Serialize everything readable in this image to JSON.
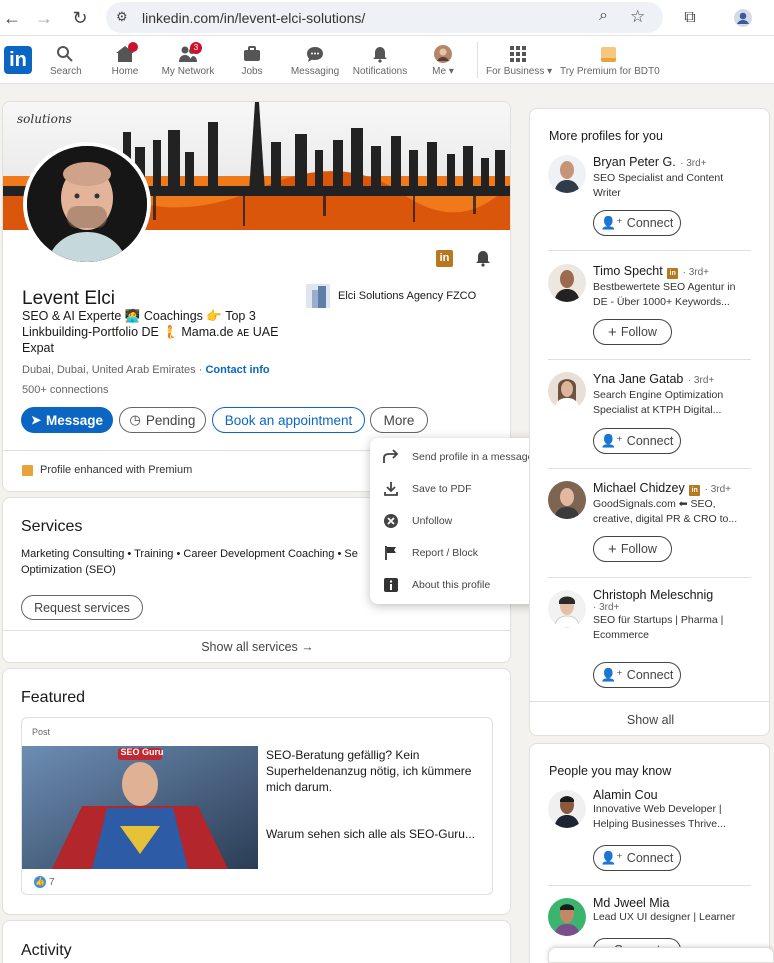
{
  "browser": {
    "url": "linkedin.com/in/levent-elci-solutions/"
  },
  "nav": {
    "items": [
      {
        "label": "Search"
      },
      {
        "label": "Home"
      },
      {
        "label": "My Network",
        "badge": "3"
      },
      {
        "label": "Jobs"
      },
      {
        "label": "Messaging"
      },
      {
        "label": "Notifications"
      },
      {
        "label": "Me"
      },
      {
        "label": "For Business"
      },
      {
        "label": "Try Premium for BDT0"
      }
    ]
  },
  "profile": {
    "banner_logo": "solutions",
    "name": "Levent Elci",
    "headline": "SEO & AI Experte 🧑‍💻 Coachings 👉 Top 3 Linkbuilding-Portfolio DE 🧜 Mama.de 🇦🇪 UAE Expat",
    "headline_1": "SEO & AI Experte 🧑‍💻 Coachings 👉 Top 3",
    "headline_2": "Linkbuilding-Portfolio DE 🧜 Mama.de ᴀᴇ UAE",
    "headline_3": "Expat",
    "location": "Dubai, Dubai, United Arab Emirates ·",
    "contact_info": "Contact info",
    "connections": "500+ connections",
    "company": "Elci Solutions Agency FZCO",
    "buttons": {
      "message": "Message",
      "pending": "Pending",
      "appointment": "Book an appointment",
      "more": "More"
    },
    "premium_note": "Profile enhanced with Premium"
  },
  "dropdown": {
    "items": [
      {
        "label": "Send profile in a message",
        "icon": "share-icon"
      },
      {
        "label": "Save to PDF",
        "icon": "download-icon"
      },
      {
        "label": "Unfollow",
        "icon": "close-circle-icon"
      },
      {
        "label": "Report / Block",
        "icon": "flag-icon"
      },
      {
        "label": "About this profile",
        "icon": "info-icon"
      }
    ]
  },
  "services": {
    "title": "Services",
    "list_1": "Marketing Consulting • Training • Career Development Coaching • Se",
    "list_2": "Optimization (SEO)",
    "request": "Request services",
    "show_all": "Show all services →"
  },
  "featured": {
    "title": "Featured",
    "post_label": "Post",
    "image_text": "SEO Guru",
    "text_1": "SEO-Beratung gefällig? Kein Superheldenanzug nötig, ich kümmere mich darum.",
    "text_2": "Warum sehen sich alle als SEO-Guru...",
    "reactions": "7"
  },
  "activity": {
    "title": "Activity"
  },
  "more_profiles": {
    "title": "More profiles for you",
    "show_all": "Show all",
    "people": [
      {
        "name": "Bryan Peter G.",
        "degree": "· 3rd+",
        "desc_1": "SEO Specialist and Content",
        "desc_2": "Writer",
        "action": "Connect"
      },
      {
        "name": "Timo Specht",
        "degree": "· 3rd+",
        "desc_1": "Bestbewertete SEO Agentur in",
        "desc_2": "DE - Über 1000+ Keywords...",
        "action": "Follow"
      },
      {
        "name": "Yna Jane Gatab",
        "degree": "· 3rd+",
        "desc_1": "Search Engine Optimization",
        "desc_2": "Specialist at KTPH Digital...",
        "action": "Connect"
      },
      {
        "name": "Michael Chidzey",
        "degree": "· 3rd+",
        "desc_1": "GoodSignals.com ⬅ SEO,",
        "desc_2": "creative, digital PR & CRO to...",
        "action": "Follow"
      },
      {
        "name": "Christoph Meleschnig",
        "degree": "· 3rd+",
        "desc_1": "SEO für Startups | Pharma |",
        "desc_2": "Ecommerce",
        "action": "Connect"
      }
    ]
  },
  "people_know": {
    "title": "People you may know",
    "people": [
      {
        "name": "Alamin Cou",
        "desc_1": "Innovative Web Developer |",
        "desc_2": "Helping Businesses Thrive...",
        "action": "Connect"
      },
      {
        "name": "Md Jweel Mia",
        "desc_1": "Lead UX UI designer | Learner",
        "action": "Connect"
      }
    ]
  },
  "colors": {
    "brand": "#0a66c2",
    "premium": "#c37d16",
    "badge": "#cb112d"
  }
}
